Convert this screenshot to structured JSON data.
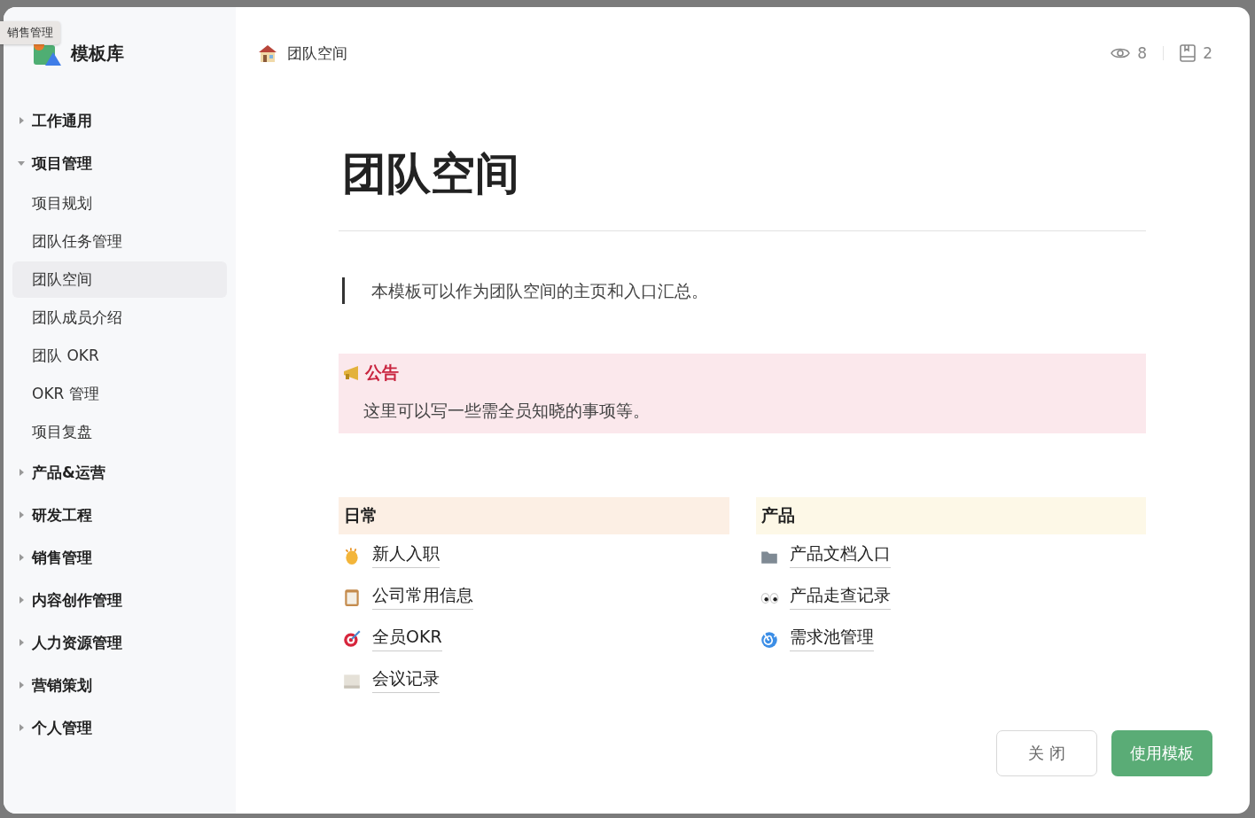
{
  "tooltip": {
    "text": "销售管理"
  },
  "sidebar": {
    "title": "模板库",
    "items": [
      {
        "label": "工作通用",
        "expanded": false
      },
      {
        "label": "项目管理",
        "expanded": true,
        "children": [
          {
            "label": "项目规划",
            "selected": false
          },
          {
            "label": "团队任务管理",
            "selected": false
          },
          {
            "label": "团队空间",
            "selected": true
          },
          {
            "label": "团队成员介绍",
            "selected": false
          },
          {
            "label": "团队 OKR",
            "selected": false
          },
          {
            "label": "OKR 管理",
            "selected": false
          },
          {
            "label": "项目复盘",
            "selected": false
          }
        ]
      },
      {
        "label": "产品&运营",
        "expanded": false
      },
      {
        "label": "研发工程",
        "expanded": false
      },
      {
        "label": "销售管理",
        "expanded": false
      },
      {
        "label": "内容创作管理",
        "expanded": false
      },
      {
        "label": "人力资源管理",
        "expanded": false
      },
      {
        "label": "营销策划",
        "expanded": false
      },
      {
        "label": "个人管理",
        "expanded": false
      }
    ]
  },
  "header": {
    "breadcrumb": "团队空间",
    "views": "8",
    "saves": "2"
  },
  "page": {
    "title": "团队空间",
    "quote": "本模板可以作为团队空间的主页和入口汇总。",
    "callout": {
      "title": "公告",
      "body": "这里可以写一些需全员知晓的事项等。"
    },
    "columns": [
      {
        "heading": "日常",
        "color": "#fcefe4",
        "links": [
          {
            "label": "新人入职",
            "kind": "clap"
          },
          {
            "label": "公司常用信息",
            "kind": "clipboard"
          },
          {
            "label": "全员OKR",
            "kind": "target"
          },
          {
            "label": "会议记录",
            "kind": "scroll"
          }
        ]
      },
      {
        "heading": "产品",
        "color": "#fdf8e7",
        "links": [
          {
            "label": "产品文档入口",
            "kind": "folder"
          },
          {
            "label": "产品走查记录",
            "kind": "eyes"
          },
          {
            "label": "需求池管理",
            "kind": "spiral"
          }
        ]
      }
    ]
  },
  "footer": {
    "buttons": [
      {
        "label": "关 闭",
        "kind": "secondary"
      },
      {
        "label": "使用模板",
        "kind": "primary"
      }
    ]
  }
}
